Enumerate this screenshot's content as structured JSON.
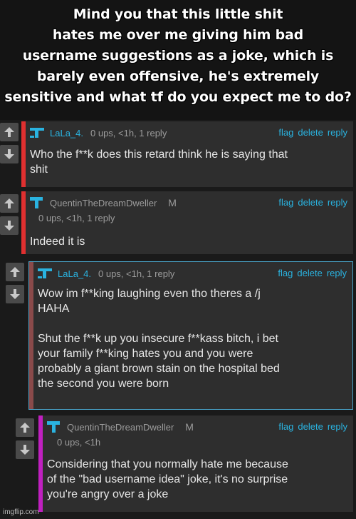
{
  "caption": {
    "lines": [
      "Mind you that this little shit",
      "hates me over me giving him bad",
      "username suggestions as a joke, which is",
      "barely even offensive, he's extremely",
      "sensitive and what tf do you expect me to do?"
    ]
  },
  "actions": {
    "flag": "flag",
    "delete": "delete",
    "reply": "reply"
  },
  "comments": [
    {
      "username": "LaLa_4.",
      "meta": "0 ups, <1h, 1 reply",
      "body": "Who the f**k does this retard think he is saying that\nshit",
      "bar_color": "#e03030"
    },
    {
      "username": "QuentinTheDreamDweller",
      "mod": "M",
      "meta": "0 ups, <1h, 1 reply",
      "body": "Indeed it is",
      "bar_color": "#e03030"
    },
    {
      "username": "LaLa_4.",
      "meta": "0 ups, <1h, 1 reply",
      "body": "Wow im f**king laughing even tho theres a /j\nHAHA\n\nShut the f**k up you insecure f**kass bitch, i bet\nyour family f**king hates you and you were\nprobably a giant brown stain on the hospital bed\nthe second you were born",
      "bar_color": "#8a4a4a"
    },
    {
      "username": "QuentinTheDreamDweller",
      "mod": "M",
      "meta": "0 ups, <1h",
      "body": "Considering that you normally hate me because\nof the \"bad username idea\" joke, it's no surprise\nyou're angry over a joke",
      "bar_color": "#c020c0"
    }
  ],
  "watermark": "imgflip.com",
  "colors": {
    "link": "#2ab3e0",
    "card": "#2e2e2e",
    "highlight_border": "#4aa3c8"
  }
}
